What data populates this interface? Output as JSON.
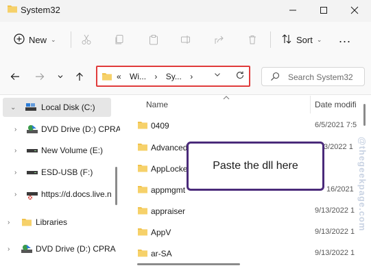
{
  "window": {
    "title": "System32"
  },
  "toolbar": {
    "new_label": "New",
    "sort_label": "Sort",
    "more_label": "..."
  },
  "address": {
    "segments": [
      "«",
      "Wi...",
      "›",
      "Sy...",
      "›"
    ]
  },
  "search": {
    "placeholder": "Search System32"
  },
  "sidebar": {
    "items": [
      {
        "label": "Local Disk (C:)",
        "icon": "drive-icon",
        "selected": true
      },
      {
        "label": "DVD Drive (D:) CPRA",
        "icon": "dvd-icon"
      },
      {
        "label": "New Volume (E:)",
        "icon": "drive-icon"
      },
      {
        "label": "ESD-USB (F:)",
        "icon": "drive-icon"
      },
      {
        "label": "https://d.docs.live.n",
        "icon": "network-drive-icon"
      },
      {
        "label": "Libraries",
        "icon": "folder-icon"
      },
      {
        "label": "DVD Drive (D:) CPRA",
        "icon": "dvd-icon"
      }
    ]
  },
  "content": {
    "columns": {
      "name": "Name",
      "date": "Date modifi"
    },
    "rows": [
      {
        "name": "0409",
        "date": "6/5/2021 7:5"
      },
      {
        "name": "Advanced",
        "date": "3/2022 1"
      },
      {
        "name": "AppLocke",
        "date": ""
      },
      {
        "name": "appmgmt",
        "date": "16/2021"
      },
      {
        "name": "appraiser",
        "date": "9/13/2022 1"
      },
      {
        "name": "AppV",
        "date": "9/13/2022 1"
      },
      {
        "name": "ar-SA",
        "date": "9/13/2022 1"
      }
    ]
  },
  "callout": {
    "text": "Paste the dll here"
  },
  "watermark": {
    "text": "@thegeekpage.com"
  },
  "colors": {
    "folder": "#f0c24b",
    "callout_border": "#4a2a7a",
    "address_highlight": "#e03a3a"
  }
}
